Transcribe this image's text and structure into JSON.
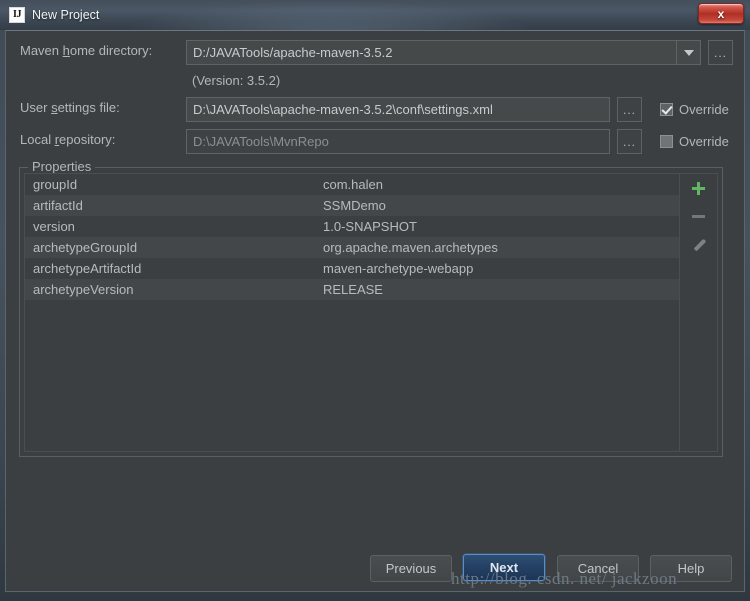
{
  "window": {
    "title": "New Project",
    "logo_text": "IJ",
    "close_label": "x"
  },
  "form": {
    "maven_home": {
      "label_pre": "Maven ",
      "label_mn": "h",
      "label_post": "ome directory:",
      "value": "D:/JAVATools/apache-maven-3.5.2",
      "browse_label": "...",
      "version_note": "(Version: 3.5.2)"
    },
    "user_settings": {
      "label_pre": "User ",
      "label_mn": "s",
      "label_post": "ettings file:",
      "value": "D:\\JAVATools\\apache-maven-3.5.2\\conf\\settings.xml",
      "browse_label": "...",
      "override_label": "Override",
      "override_checked": true
    },
    "local_repository": {
      "label_pre": "Local ",
      "label_mn": "r",
      "label_post": "epository:",
      "value": "D:\\JAVATools\\MvnRepo",
      "browse_label": "...",
      "override_label": "Override",
      "override_checked": false
    }
  },
  "properties": {
    "legend": "Properties",
    "rows": [
      {
        "key": "groupId",
        "value": "com.halen"
      },
      {
        "key": "artifactId",
        "value": "SSMDemo"
      },
      {
        "key": "version",
        "value": "1.0-SNAPSHOT"
      },
      {
        "key": "archetypeGroupId",
        "value": "org.apache.maven.archetypes"
      },
      {
        "key": "archetypeArtifactId",
        "value": "maven-archetype-webapp"
      },
      {
        "key": "archetypeVersion",
        "value": "RELEASE"
      }
    ],
    "toolbar": {
      "add_title": "Add",
      "remove_title": "Remove",
      "edit_title": "Edit"
    }
  },
  "footer": {
    "previous": "Previous",
    "next": "Next",
    "cancel": "Cancel",
    "help": "Help"
  },
  "watermark": "http://blog. csdn. net/ jackzoon",
  "colors": {
    "accent_green": "#62b562",
    "default_button_blue": "#2e4e74",
    "close_red": "#b02f25",
    "panel_bg": "#3c3f41"
  }
}
